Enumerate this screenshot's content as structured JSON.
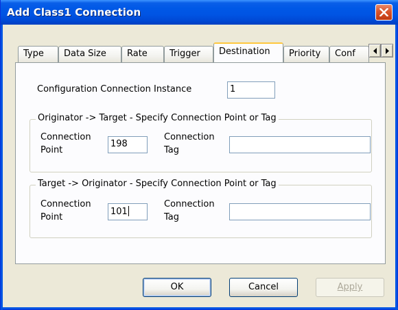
{
  "window": {
    "title": "Add Class1 Connection"
  },
  "tabs": [
    {
      "label": "Type"
    },
    {
      "label": "Data Size"
    },
    {
      "label": "Rate"
    },
    {
      "label": "Trigger"
    },
    {
      "label": "Destination",
      "active": true
    },
    {
      "label": "Priority"
    },
    {
      "label": "Conf"
    }
  ],
  "config_instance": {
    "label": "Configuration Connection Instance",
    "value": "1"
  },
  "o_to_t": {
    "legend": "Originator -> Target - Specify Connection Point or Tag",
    "point_label_1": "Connection",
    "point_label_2": "Point",
    "point_value": "198",
    "tag_label_1": "Connection",
    "tag_label_2": "Tag",
    "tag_value": ""
  },
  "t_to_o": {
    "legend": "Target -> Originator - Specify Connection Point or Tag",
    "point_label_1": "Connection",
    "point_label_2": "Point",
    "point_value": "101",
    "tag_label_1": "Connection",
    "tag_label_2": "Tag",
    "tag_value": ""
  },
  "buttons": {
    "ok": "OK",
    "cancel": "Cancel",
    "apply": "Apply"
  },
  "icons": {
    "close": "close-icon",
    "left": "arrow-left-icon",
    "right": "arrow-right-icon"
  },
  "colors": {
    "titlebar": "#0054e3",
    "close": "#d9542b",
    "tab_highlight": "#ffc73c",
    "face": "#ece9d8"
  }
}
